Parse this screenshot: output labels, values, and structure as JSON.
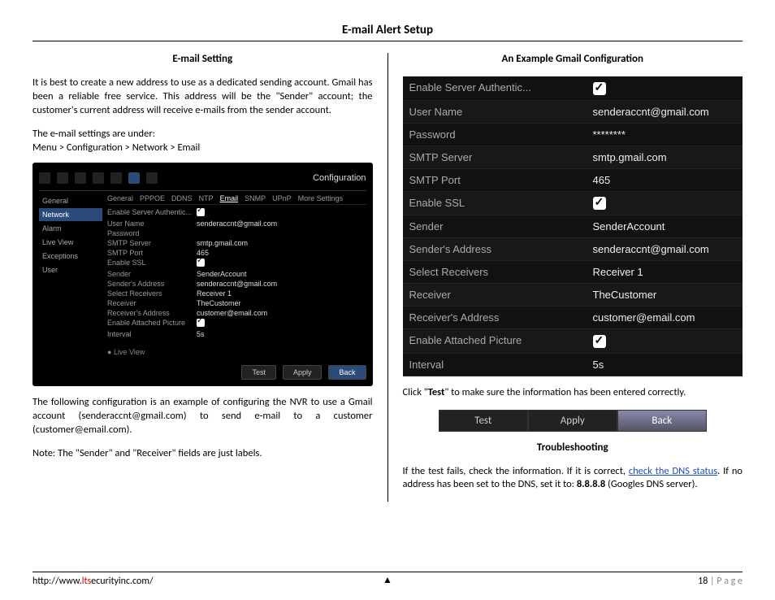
{
  "title": "E-mail Alert Setup",
  "left": {
    "heading": "E-mail Setting",
    "p1": "It is best to create a new address to use as a dedicated sending account.  Gmail has been a reliable free service.  This address will be the \"Sender\" account; the customer's current address will receive e-mails from the sender account.",
    "p2a": "The e-mail settings are under:",
    "p2b": "Menu > Configuration > Network > Email",
    "shot": {
      "config_label": "Configuration",
      "side": [
        "General",
        "Network",
        "Alarm",
        "Live View",
        "Exceptions",
        "User"
      ],
      "side_prefix": {
        "General": "⦿",
        "Network": "⚙",
        "Alarm": "●",
        "Live View": "○",
        "Exceptions": "▲",
        "User": "👤"
      },
      "tabs": [
        "General",
        "PPPOE",
        "DDNS",
        "NTP",
        "Email",
        "SNMP",
        "UPnP",
        "More Settings"
      ],
      "rows": [
        {
          "k": "Enable Server Authentic...",
          "v": "cb"
        },
        {
          "k": "User Name",
          "v": "senderaccnt@gmail.com"
        },
        {
          "k": "Password",
          "v": ""
        },
        {
          "k": "SMTP Server",
          "v": "smtp.gmail.com"
        },
        {
          "k": "SMTP Port",
          "v": "465"
        },
        {
          "k": "Enable SSL",
          "v": "cb"
        },
        {
          "k": "Sender",
          "v": "SenderAccount"
        },
        {
          "k": "Sender's Address",
          "v": "senderaccnt@gmail.com"
        },
        {
          "k": "Select Receivers",
          "v": "Receiver 1"
        },
        {
          "k": "Receiver",
          "v": "TheCustomer"
        },
        {
          "k": "Receiver's Address",
          "v": "customer@email.com"
        },
        {
          "k": "Enable Attached Picture",
          "v": "cb"
        },
        {
          "k": "Interval",
          "v": "5s"
        }
      ],
      "live_view": "Live View",
      "btn_test": "Test",
      "btn_apply": "Apply",
      "btn_back": "Back"
    },
    "p3": "The following configuration is an example of configuring the NVR to use a Gmail account (senderaccnt@gmail.com) to send e-mail to a customer (customer@email.com).",
    "p4": "Note: The \"Sender\" and \"Receiver\" fields are just labels."
  },
  "right": {
    "heading": "An Example Gmail Configuration",
    "rows": [
      {
        "k": "Enable Server Authentic...",
        "v": "cb"
      },
      {
        "k": "User Name",
        "v": "senderaccnt@gmail.com"
      },
      {
        "k": "Password",
        "v": "********"
      },
      {
        "k": "SMTP Server",
        "v": "smtp.gmail.com"
      },
      {
        "k": "SMTP Port",
        "v": "465"
      },
      {
        "k": "Enable SSL",
        "v": "cb"
      },
      {
        "k": "Sender",
        "v": "SenderAccount"
      },
      {
        "k": "Sender's Address",
        "v": "senderaccnt@gmail.com"
      },
      {
        "k": "Select Receivers",
        "v": "Receiver 1"
      },
      {
        "k": "Receiver",
        "v": "TheCustomer"
      },
      {
        "k": "Receiver's Address",
        "v": "customer@email.com"
      },
      {
        "k": "Enable Attached Picture",
        "v": "cb"
      },
      {
        "k": "Interval",
        "v": "5s"
      }
    ],
    "p1a": "Click \"",
    "p1b": "Test",
    "p1c": "\" to make sure the information has been entered correctly.",
    "btn_test": "Test",
    "btn_apply": "Apply",
    "btn_back": "Back",
    "h2": "Troubleshooting",
    "p2a": "If the test fails, check the information.  If it is correct, ",
    "p2link": "check the DNS status",
    "p2b": ".  If no address has been set to the DNS, set it to: ",
    "p2c": "8.8.8.8",
    "p2d": " (Googles DNS server)."
  },
  "footer": {
    "url_a": "http://www.",
    "url_b": "lts",
    "url_c": "ecurityinc.com/",
    "tri": "▲",
    "page_num": "18",
    "page_lbl": " | P a g e"
  }
}
